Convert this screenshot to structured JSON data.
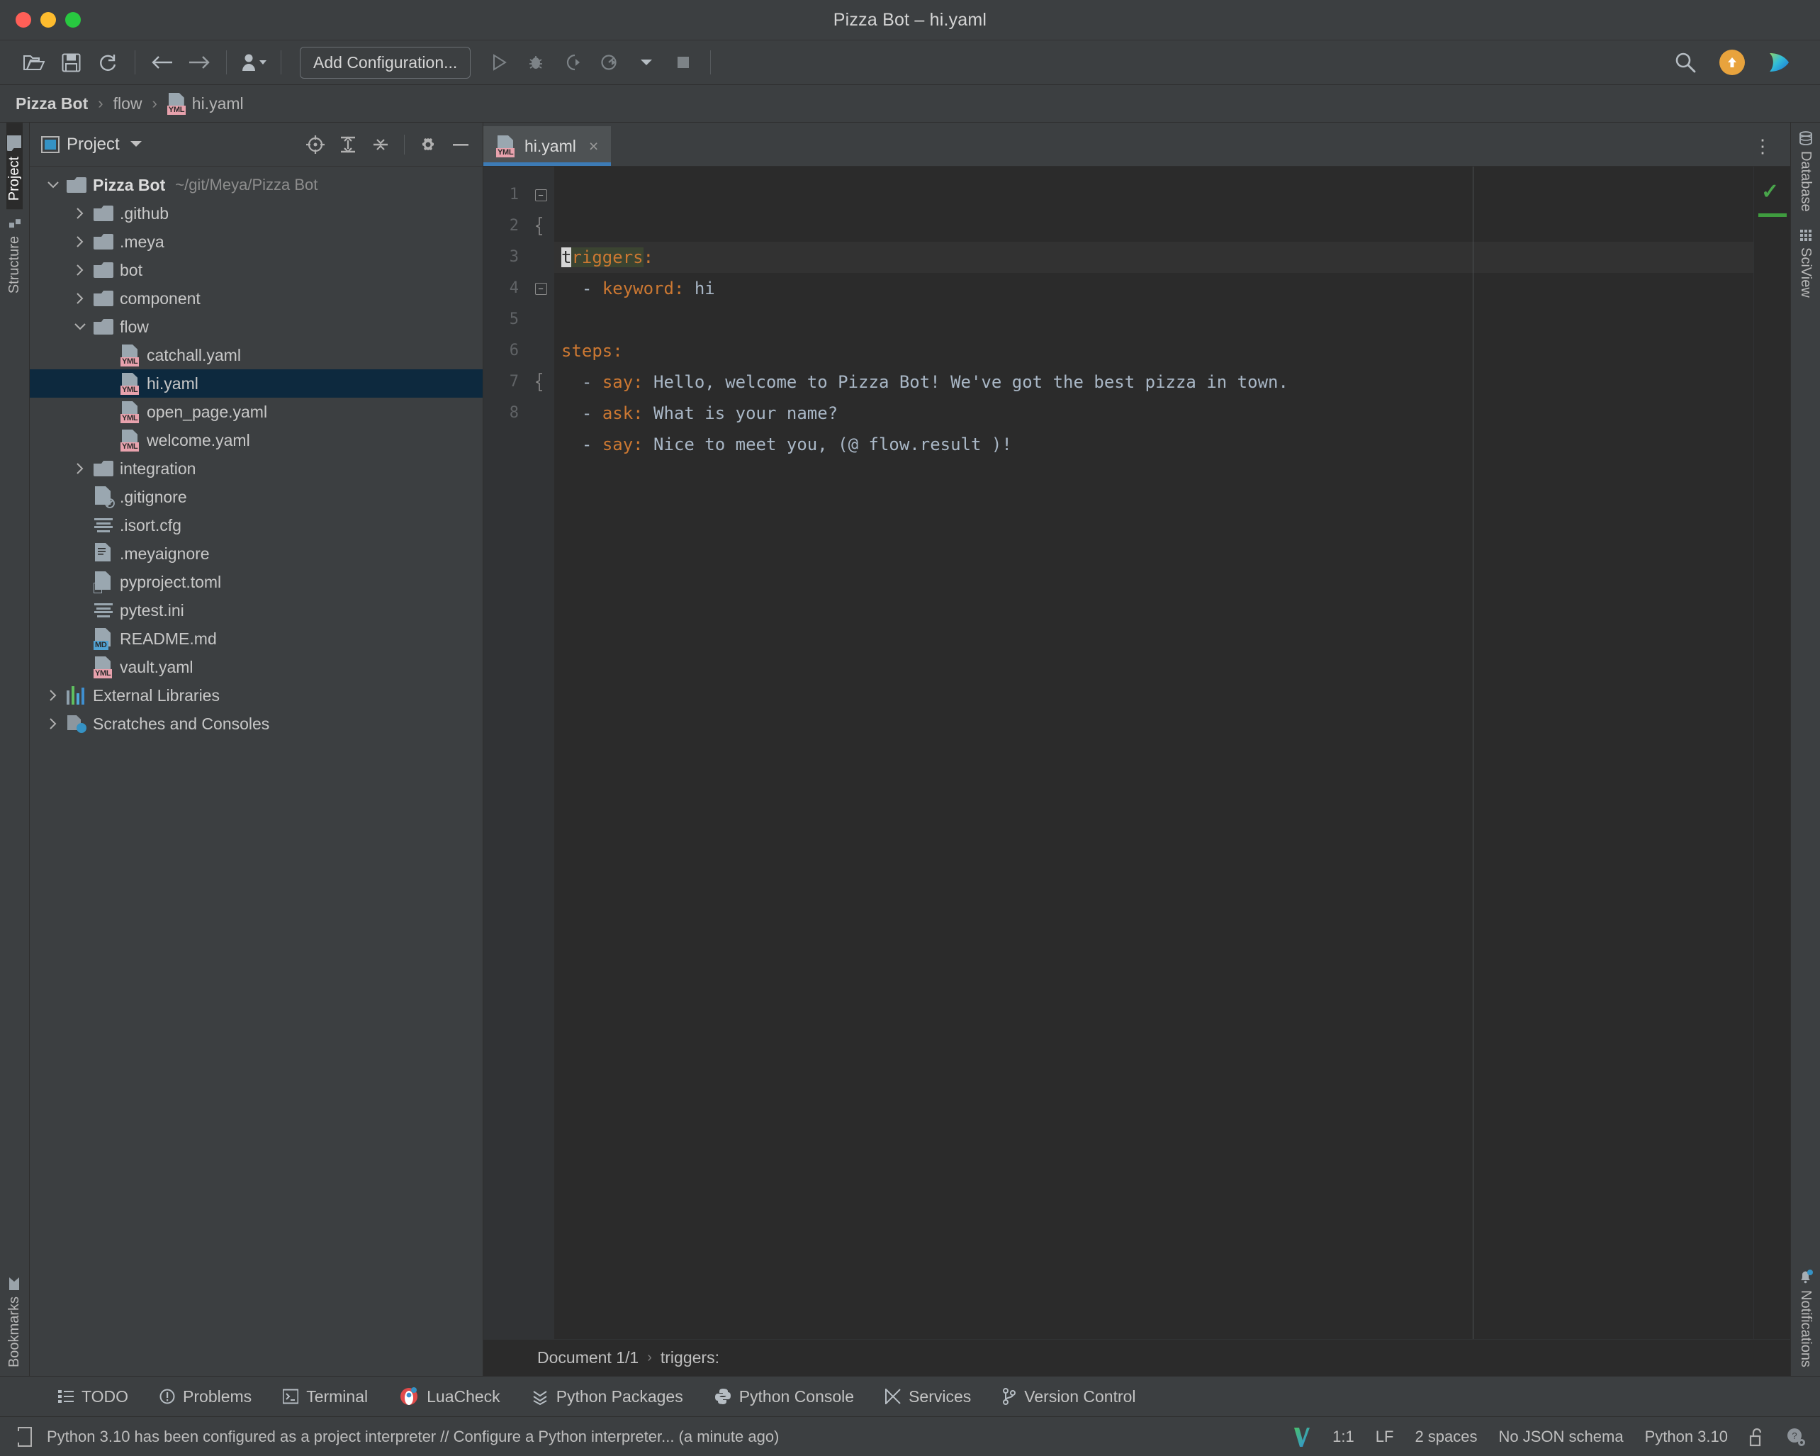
{
  "window": {
    "title": "Pizza Bot – hi.yaml",
    "traffic_lights": [
      "close",
      "minimize",
      "maximize"
    ]
  },
  "toolbar": {
    "open_label": "open-folder-icon",
    "save_label": "save-icon",
    "sync_label": "sync-icon",
    "back_label": "back-arrow-icon",
    "forward_label": "forward-arrow-icon",
    "profiles_label": "user-profile-icon",
    "add_configuration": "Add Configuration...",
    "run_label": "run-icon",
    "debug_label": "debug-icon",
    "coverage_label": "run-coverage-icon",
    "profile_label": "profile-icon",
    "stop_label": "stop-icon",
    "search_label": "search-icon",
    "update_label": "update-icon",
    "meya_label": "meya-logo-icon"
  },
  "breadcrumb": {
    "items": [
      "Pizza Bot",
      "flow",
      "hi.yaml"
    ],
    "separator": "›"
  },
  "left_stripe": {
    "top": [
      {
        "label": "Project",
        "active": true
      },
      {
        "label": "Structure",
        "active": false
      }
    ],
    "bottom": [
      {
        "label": "Bookmarks",
        "active": false
      }
    ]
  },
  "right_stripe": {
    "top": [
      {
        "label": "Database",
        "active": false
      },
      {
        "label": "SciView",
        "active": false
      }
    ],
    "bottom": [
      {
        "label": "Notifications",
        "active": false
      }
    ]
  },
  "project_panel": {
    "title": "Project",
    "icons": [
      "select-opened-file-icon",
      "expand-all-icon",
      "collapse-all-icon",
      "settings-gear-icon",
      "hide-icon"
    ],
    "tree": [
      {
        "label": "Pizza Bot",
        "sub": "~/git/Meya/Pizza Bot",
        "indent": 0,
        "arrow": "down",
        "icon": "folder",
        "bold": true
      },
      {
        "label": ".github",
        "indent": 1,
        "arrow": "right",
        "icon": "folder"
      },
      {
        "label": ".meya",
        "indent": 1,
        "arrow": "right",
        "icon": "folder"
      },
      {
        "label": "bot",
        "indent": 1,
        "arrow": "right",
        "icon": "folder"
      },
      {
        "label": "component",
        "indent": 1,
        "arrow": "right",
        "icon": "folder"
      },
      {
        "label": "flow",
        "indent": 1,
        "arrow": "down",
        "icon": "folder"
      },
      {
        "label": "catchall.yaml",
        "indent": 2,
        "arrow": "none",
        "icon": "yml"
      },
      {
        "label": "hi.yaml",
        "indent": 2,
        "arrow": "none",
        "icon": "yml",
        "selected": true
      },
      {
        "label": "open_page.yaml",
        "indent": 2,
        "arrow": "none",
        "icon": "yml"
      },
      {
        "label": "welcome.yaml",
        "indent": 2,
        "arrow": "none",
        "icon": "yml"
      },
      {
        "label": "integration",
        "indent": 1,
        "arrow": "right",
        "icon": "folder"
      },
      {
        "label": ".gitignore",
        "indent": 1,
        "arrow": "none",
        "icon": "gitignore"
      },
      {
        "label": ".isort.cfg",
        "indent": 1,
        "arrow": "none",
        "icon": "lines"
      },
      {
        "label": ".meyaignore",
        "indent": 1,
        "arrow": "none",
        "icon": "text"
      },
      {
        "label": "pyproject.toml",
        "indent": 1,
        "arrow": "none",
        "icon": "toml"
      },
      {
        "label": "pytest.ini",
        "indent": 1,
        "arrow": "none",
        "icon": "lines"
      },
      {
        "label": "README.md",
        "indent": 1,
        "arrow": "none",
        "icon": "md"
      },
      {
        "label": "vault.yaml",
        "indent": 1,
        "arrow": "none",
        "icon": "yml"
      },
      {
        "label": "External Libraries",
        "indent": 0,
        "arrow": "right",
        "icon": "libraries"
      },
      {
        "label": "Scratches and Consoles",
        "indent": 0,
        "arrow": "right",
        "icon": "scratches"
      }
    ]
  },
  "editor": {
    "tab": {
      "label": "hi.yaml",
      "icon": "yml-file-icon",
      "close": "×",
      "active": true
    },
    "options_icon": "⋮",
    "inspection_status": "✓",
    "line_numbers": [
      "1",
      "2",
      "3",
      "4",
      "5",
      "6",
      "7",
      "8"
    ],
    "lines": [
      {
        "n": 1,
        "fold": "minus",
        "key": "triggers",
        "colon": ":",
        "value": "",
        "indent": 0,
        "current": true,
        "highlight": true
      },
      {
        "n": 2,
        "fold": "brace",
        "dash": "- ",
        "key": "keyword",
        "colon": ":",
        "value": " hi",
        "indent": 1
      },
      {
        "n": 3,
        "fold": "",
        "raw": "",
        "indent": 0
      },
      {
        "n": 4,
        "fold": "minus",
        "key": "steps",
        "colon": ":",
        "value": "",
        "indent": 0
      },
      {
        "n": 5,
        "fold": "",
        "dash": "- ",
        "key": "say",
        "colon": ":",
        "value": " Hello, welcome to Pizza Bot! We've got the best pizza in town.",
        "indent": 1
      },
      {
        "n": 6,
        "fold": "",
        "dash": "- ",
        "key": "ask",
        "colon": ":",
        "value": " What is your name?",
        "indent": 1
      },
      {
        "n": 7,
        "fold": "brace",
        "dash": "- ",
        "key": "say",
        "colon": ":",
        "value": " Nice to meet you, (@ flow.result )!",
        "indent": 1
      },
      {
        "n": 8,
        "fold": "",
        "raw": "",
        "indent": 0
      }
    ],
    "crumbs": [
      "Document 1/1",
      "triggers:"
    ],
    "crumb_separator": "›"
  },
  "tool_windows": [
    {
      "label": "TODO",
      "icon": "todo-list-icon"
    },
    {
      "label": "Problems",
      "icon": "problems-icon"
    },
    {
      "label": "Terminal",
      "icon": "terminal-icon"
    },
    {
      "label": "LuaCheck",
      "icon": "luacheck-icon"
    },
    {
      "label": "Python Packages",
      "icon": "python-packages-icon"
    },
    {
      "label": "Python Console",
      "icon": "python-console-icon"
    },
    {
      "label": "Services",
      "icon": "services-icon"
    },
    {
      "label": "Version Control",
      "icon": "version-control-icon"
    }
  ],
  "status_bar": {
    "message": "Python 3.10 has been configured as a project interpreter // Configure a Python interpreter... (a minute ago)",
    "message_icon": "event-log-icon",
    "right": {
      "vcs_icon": "vim-logo-icon",
      "caret_position": "1:1",
      "line_separator": "LF",
      "indent": "2 spaces",
      "schema": "No JSON schema",
      "interpreter": "Python 3.10",
      "lock_icon": "unlocked-icon",
      "settings_icon": "ide-settings-icon"
    }
  },
  "colors": {
    "accent_blue": "#3d7bb5",
    "selection_blue": "#0d293e",
    "yaml_key_orange": "#cc7832",
    "yaml_value": "#a9b7c6",
    "editor_bg": "#2b2b2b",
    "panel_bg": "#3c3f41",
    "gutter_bg": "#313335",
    "success_green": "#49a54b",
    "update_orange": "#e8a33d",
    "yml_badge": "#e8a2ad",
    "md_badge": "#51a3d4"
  }
}
